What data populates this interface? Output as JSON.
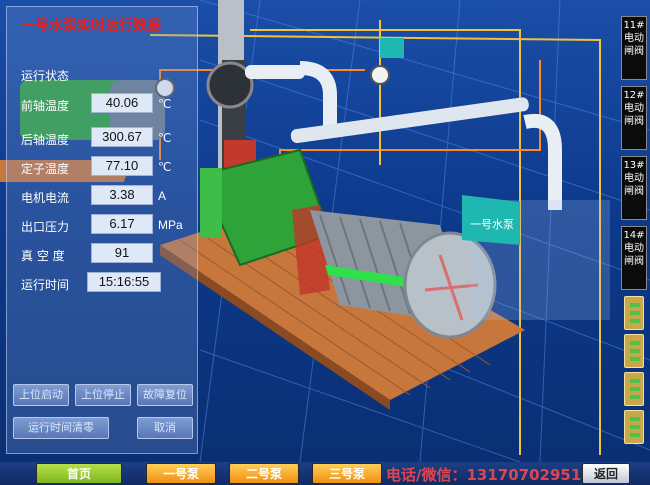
{
  "panel": {
    "title": "一号水泵实时运行数据",
    "status_label": "运行状态",
    "rows": [
      {
        "label": "前轴温度",
        "value": "40.06",
        "unit": "℃"
      },
      {
        "label": "后轴温度",
        "value": "300.67",
        "unit": "℃"
      },
      {
        "label": "定子温度",
        "value": "77.10",
        "unit": "℃"
      },
      {
        "label": "电机电流",
        "value": "3.38",
        "unit": "A"
      },
      {
        "label": "出口压力",
        "value": "6.17",
        "unit": "MPa"
      },
      {
        "label": "真 空 度",
        "value": "91",
        "unit": ""
      },
      {
        "label": "运行时间",
        "value": "15:16:55",
        "unit": ""
      }
    ]
  },
  "controls": {
    "start": "上位启动",
    "stop": "上位停止",
    "fault_reset": "故障复位",
    "clear_runtime": "运行时间清零",
    "cancel": "取消"
  },
  "valves": [
    "11#电动闸阀",
    "12#电动闸阀",
    "13#电动闸阀",
    "14#电动闸阀"
  ],
  "scene": {
    "pump_sign": "一号水泵"
  },
  "nav": {
    "home": "首页",
    "pump1": "一号泵",
    "pump2": "二号泵",
    "pump3": "三号泵",
    "back": "返回"
  },
  "watermark": "电话/微信：13170702951",
  "colors": {
    "background": "#0d3a8c",
    "title_red": "#e0201c",
    "motor_green": "#2ea33a",
    "nav_orange": "#ef8f12",
    "nav_green": "#7fb51f"
  }
}
